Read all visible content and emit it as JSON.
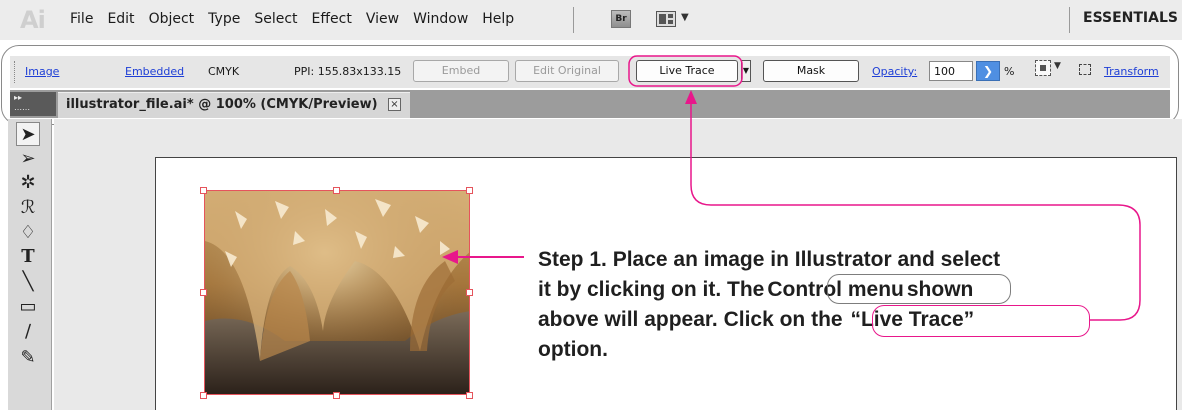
{
  "menubar": {
    "logo": "Ai",
    "items": [
      "File",
      "Edit",
      "Object",
      "Type",
      "Select",
      "Effect",
      "View",
      "Window",
      "Help"
    ],
    "bridge_label": "Br",
    "workspace": "ESSENTIALS"
  },
  "control": {
    "image_label": "Image",
    "embedded_label": "Embedded",
    "color_mode": "CMYK",
    "ppi": "PPI: 155.83x133.15",
    "embed_button": "Embed",
    "edit_original_button": "Edit Original",
    "live_trace_button": "Live Trace",
    "mask_button": "Mask",
    "opacity_label": "Opacity:",
    "opacity_value": "100",
    "percent": "%",
    "transform_label": "Transform"
  },
  "document": {
    "tab_title": "illustrator_file.ai* @ 100% (CMYK/Preview)",
    "close_glyph": "×"
  },
  "tools": [
    "selection-tool",
    "direct-selection-tool",
    "magic-wand-tool",
    "lasso-tool",
    "pen-tool",
    "type-tool",
    "line-tool",
    "rectangle-tool",
    "paintbrush-tool",
    "pencil-tool"
  ],
  "annotation": {
    "line1": "Step 1. Place an image in Illustrator and select",
    "line2_pre": "it by clicking on it. The",
    "line2_highlight": "Control menu",
    "line2_post": "shown",
    "line3_pre": "above will appear. Click on the",
    "line3_highlight": "“Live Trace”",
    "line4": "option."
  },
  "colors": {
    "accent_pink": "#e8178b",
    "link_blue": "#1f3fd6",
    "selection_red": "#e5545c"
  }
}
